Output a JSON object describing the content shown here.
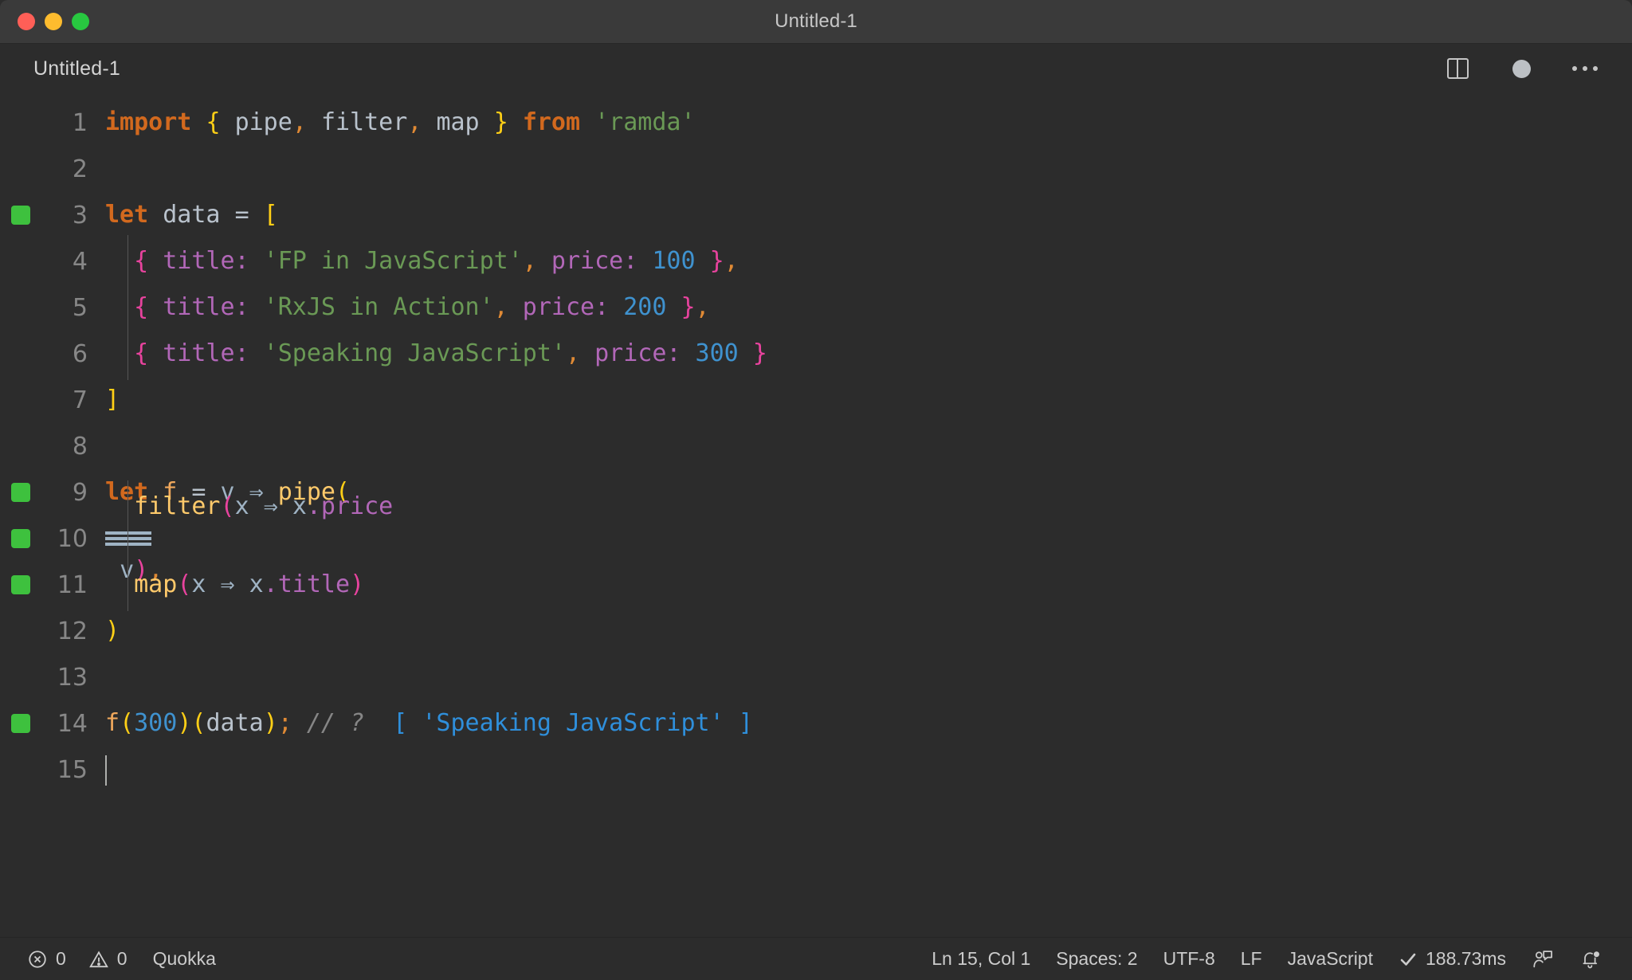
{
  "window": {
    "title": "Untitled-1",
    "traffic_lights": [
      "close-button",
      "minimize-button",
      "maximize-button"
    ]
  },
  "tabbar": {
    "tab_label": "Untitled-1",
    "actions": {
      "split_editor": "split-editor-right-icon",
      "unsaved_indicator": "unsaved-dot-icon",
      "more_actions": "more-actions-icon"
    }
  },
  "editor": {
    "language": "JavaScript",
    "lines": [
      {
        "n": "1",
        "marker": false
      },
      {
        "n": "2",
        "marker": false
      },
      {
        "n": "3",
        "marker": true
      },
      {
        "n": "4",
        "marker": false
      },
      {
        "n": "5",
        "marker": false
      },
      {
        "n": "6",
        "marker": false
      },
      {
        "n": "7",
        "marker": false
      },
      {
        "n": "8",
        "marker": false
      },
      {
        "n": "9",
        "marker": true
      },
      {
        "n": "10",
        "marker": true
      },
      {
        "n": "11",
        "marker": true
      },
      {
        "n": "12",
        "marker": false
      },
      {
        "n": "13",
        "marker": false
      },
      {
        "n": "14",
        "marker": true
      },
      {
        "n": "15",
        "marker": false
      }
    ],
    "code": {
      "l1_import": "import",
      "l1_brace_open": "{",
      "l1_pipe": "pipe",
      "l1_comma1": ",",
      "l1_filter": "filter",
      "l1_comma2": ",",
      "l1_map": "map",
      "l1_brace_close": "}",
      "l1_from": "from",
      "l1_module": "'ramda'",
      "l3_let": "let",
      "l3_data": "data",
      "l3_eq": "=",
      "l3_bracket": "[",
      "l4_brace_open": "{",
      "l4_title_key": "title:",
      "l4_title_val": "'FP in JavaScript'",
      "l4_comma": ",",
      "l4_price_key": "price:",
      "l4_price_val": "100",
      "l4_brace_close": "}",
      "l4_trailing_comma": ",",
      "l5_brace_open": "{",
      "l5_title_key": "title:",
      "l5_title_val": "'RxJS in Action'",
      "l5_comma": ",",
      "l5_price_key": "price:",
      "l5_price_val": "200",
      "l5_brace_close": "}",
      "l5_trailing_comma": ",",
      "l6_brace_open": "{",
      "l6_title_key": "title:",
      "l6_title_val": "'Speaking JavaScript'",
      "l6_comma": ",",
      "l6_price_key": "price:",
      "l6_price_val": "300",
      "l6_brace_close": "}",
      "l7_bracket": "]",
      "l9_let": "let",
      "l9_f": "f",
      "l9_eq": "=",
      "l9_v": "v",
      "l9_arrow": "⇒",
      "l9_pipe": "pipe",
      "l9_paren": "(",
      "l10_filter": "filter",
      "l10_paren_open": "(",
      "l10_x": "x",
      "l10_arrow": "⇒",
      "l10_xprice": "x.price",
      "l10_eqeqeq": "≡",
      "l10_v": "v",
      "l10_paren_close": ")",
      "l10_comma": ",",
      "l11_map": "map",
      "l11_paren_open": "(",
      "l11_x": "x",
      "l11_arrow": "⇒",
      "l11_xtitle": "x.title",
      "l11_paren_close": ")",
      "l12_paren_close": ")",
      "l14_f": "f",
      "l14_paren_open1": "(",
      "l14_300": "300",
      "l14_paren_close1": ")",
      "l14_paren_open2": "(",
      "l14_data": "data",
      "l14_paren_close2": ")",
      "l14_semicolon": ";",
      "l14_comment": "// ?",
      "l14_result": "[ 'Speaking JavaScript' ]"
    }
  },
  "statusbar": {
    "errors_icon": "error-circle-icon",
    "errors_count": "0",
    "warnings_icon": "warning-triangle-icon",
    "warnings_count": "0",
    "quokka_label": "Quokka",
    "cursor_position": "Ln 15, Col 1",
    "indentation": "Spaces: 2",
    "encoding": "UTF-8",
    "eol": "LF",
    "language_mode": "JavaScript",
    "run_check_icon": "check-icon",
    "run_time": "188.73ms",
    "feedback_icon": "feedback-person-icon",
    "notifications_icon": "bell-dot-icon"
  },
  "colors": {
    "window_chrome": "#3a3a3a",
    "editor_bg": "#2c2c2c",
    "accent_green": "#3ec13e",
    "quokka_value": "#2f8fdb",
    "keyword": "#d2691e",
    "string": "#6a9955",
    "number": "#3f92cf",
    "property": "#b267b8",
    "function": "#ffca6b",
    "brace_yellow": "#ffcf16",
    "brace_pink": "#e8439e"
  }
}
